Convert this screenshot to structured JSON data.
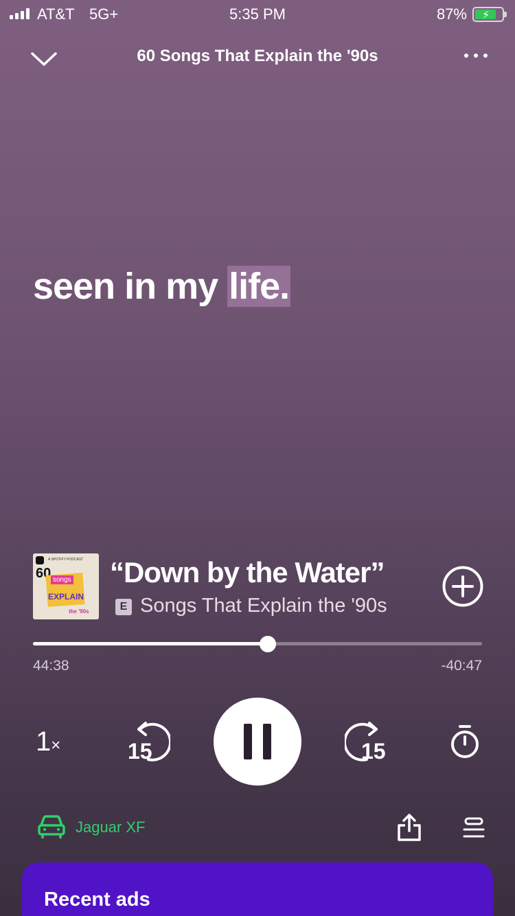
{
  "status_bar": {
    "carrier": "AT&T",
    "network": "5G+",
    "time": "5:35 PM",
    "battery_percent": "87%"
  },
  "header": {
    "title": "60 Songs That Explain the '90s"
  },
  "lyrics": {
    "line_before": "seen in my ",
    "highlighted_word": "life."
  },
  "track": {
    "title": "“Down by the Water”",
    "explicit_badge": "E",
    "show": "Songs That Explain the '90s",
    "artwork": {
      "label_top": "A SPOTIFY PODCAST",
      "number": "60",
      "songs": "songs",
      "that": "THAT",
      "explain": "EXPLAIN",
      "era": "the '90s"
    }
  },
  "playback": {
    "elapsed": "44:38",
    "remaining": "-40:47",
    "progress_fraction": 0.523,
    "speed": "1",
    "speed_suffix": "×",
    "skip_back_seconds": "15",
    "skip_forward_seconds": "15",
    "state": "playing"
  },
  "device": {
    "name": "Jaguar XF",
    "color": "#2ed06b"
  },
  "ads_panel": {
    "title": "Recent ads",
    "color": "#5113c6"
  },
  "icons": [
    "signal-icon",
    "battery-icon",
    "chevron-down-icon",
    "more-icon",
    "add-circle-icon",
    "rewind-15-icon",
    "pause-icon",
    "forward-15-icon",
    "sleep-timer-icon",
    "car-icon",
    "share-icon",
    "queue-icon"
  ]
}
